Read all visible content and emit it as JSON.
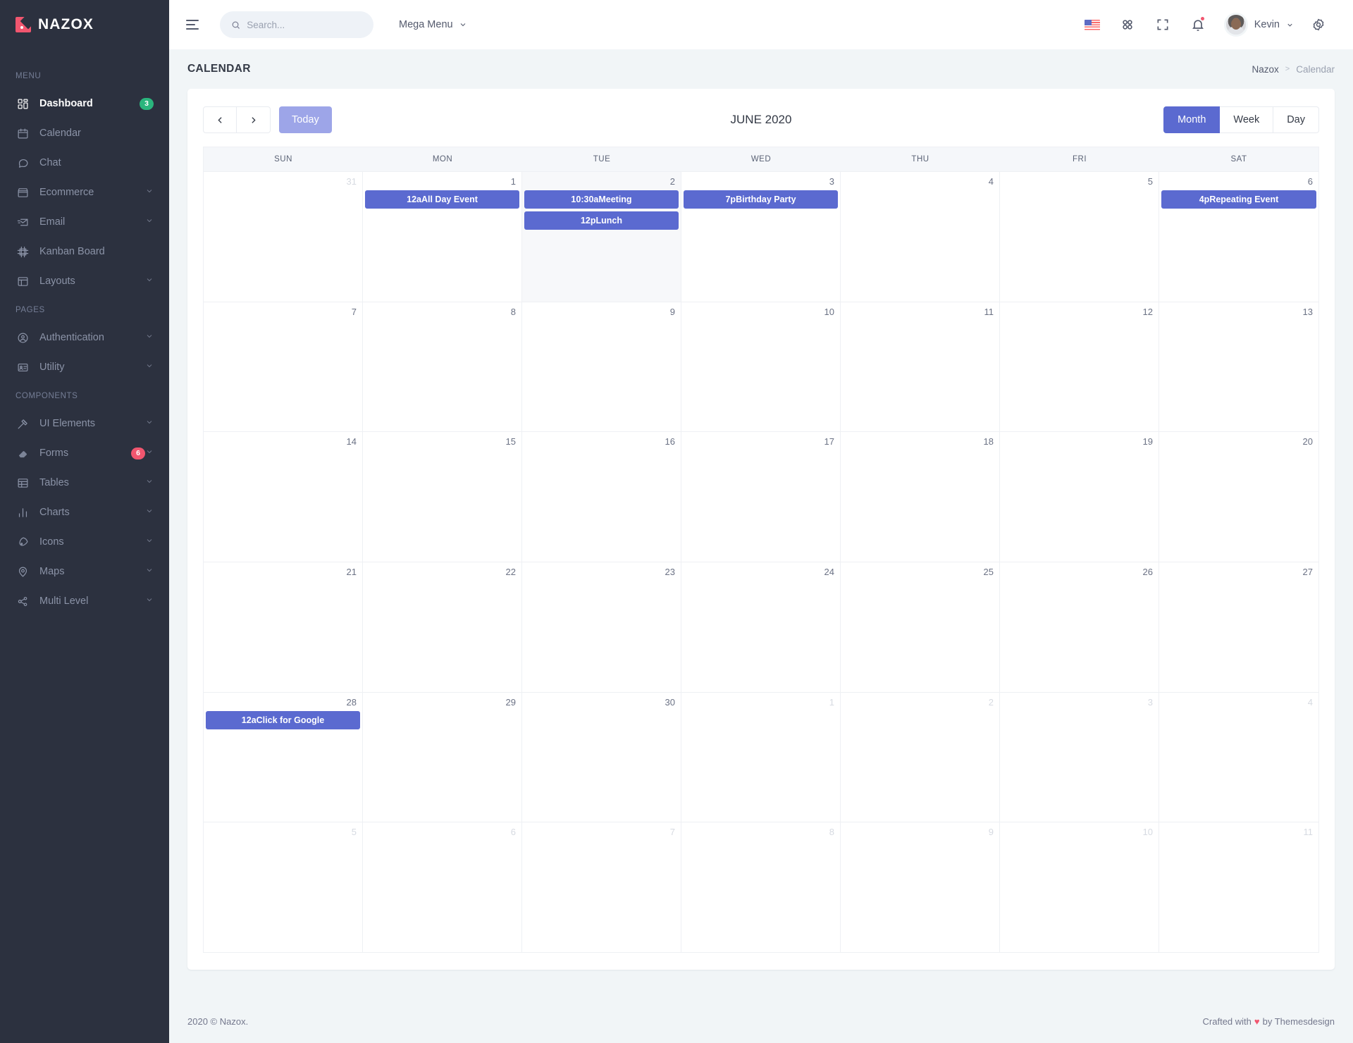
{
  "brand": {
    "name": "NAZOX",
    "logo_color": "#f1566f"
  },
  "sidebar": {
    "sections": [
      {
        "title": "MENU",
        "items": [
          {
            "label": "Dashboard",
            "icon": "grid-icon",
            "badge": "3",
            "badge_color": "#2ab57d",
            "active": true,
            "caret": false
          },
          {
            "label": "Calendar",
            "icon": "calendar-icon",
            "caret": false
          },
          {
            "label": "Chat",
            "icon": "chat-icon",
            "caret": false
          },
          {
            "label": "Ecommerce",
            "icon": "store-icon",
            "caret": true
          },
          {
            "label": "Email",
            "icon": "mail-icon",
            "caret": true
          },
          {
            "label": "Kanban Board",
            "icon": "kanban-icon",
            "caret": false
          },
          {
            "label": "Layouts",
            "icon": "layout-icon",
            "caret": true
          }
        ]
      },
      {
        "title": "PAGES",
        "items": [
          {
            "label": "Authentication",
            "icon": "user-circle-icon",
            "caret": true
          },
          {
            "label": "Utility",
            "icon": "id-card-icon",
            "caret": true
          }
        ]
      },
      {
        "title": "COMPONENTS",
        "items": [
          {
            "label": "UI Elements",
            "icon": "wand-icon",
            "caret": true
          },
          {
            "label": "Forms",
            "icon": "eraser-icon",
            "badge": "6",
            "badge_color": "#f1566f",
            "caret": true
          },
          {
            "label": "Tables",
            "icon": "table-icon",
            "caret": true
          },
          {
            "label": "Charts",
            "icon": "bar-chart-icon",
            "caret": true
          },
          {
            "label": "Icons",
            "icon": "rocket-icon",
            "caret": true
          },
          {
            "label": "Maps",
            "icon": "map-pin-icon",
            "caret": true
          },
          {
            "label": "Multi Level",
            "icon": "share-icon",
            "caret": true
          }
        ]
      }
    ]
  },
  "topbar": {
    "search_placeholder": "Search...",
    "search_value": "",
    "mega_menu_label": "Mega Menu",
    "language": "US",
    "user_name": "Kevin"
  },
  "page": {
    "title": "CALENDAR",
    "breadcrumb": [
      "Nazox",
      "Calendar"
    ],
    "breadcrumb_separator": ">"
  },
  "calendar": {
    "prev_label": "‹",
    "next_label": "›",
    "today_label": "Today",
    "title": "JUNE 2020",
    "views": [
      {
        "label": "Month",
        "active": true
      },
      {
        "label": "Week",
        "active": false
      },
      {
        "label": "Day",
        "active": false
      }
    ],
    "day_headers": [
      "SUN",
      "MON",
      "TUE",
      "WED",
      "THU",
      "FRI",
      "SAT"
    ],
    "event_color": "#5b6ad0",
    "weeks": [
      [
        {
          "num": "31",
          "other": true,
          "events": []
        },
        {
          "num": "1",
          "other": false,
          "events": [
            "12aAll Day Event"
          ]
        },
        {
          "num": "2",
          "other": false,
          "today": true,
          "events": [
            "10:30aMeeting",
            "12pLunch"
          ]
        },
        {
          "num": "3",
          "other": false,
          "events": [
            "7pBirthday Party"
          ]
        },
        {
          "num": "4",
          "other": false,
          "events": []
        },
        {
          "num": "5",
          "other": false,
          "events": []
        },
        {
          "num": "6",
          "other": false,
          "events": [
            "4pRepeating Event"
          ]
        }
      ],
      [
        {
          "num": "7",
          "other": false,
          "events": []
        },
        {
          "num": "8",
          "other": false,
          "events": []
        },
        {
          "num": "9",
          "other": false,
          "events": []
        },
        {
          "num": "10",
          "other": false,
          "events": []
        },
        {
          "num": "11",
          "other": false,
          "events": []
        },
        {
          "num": "12",
          "other": false,
          "events": []
        },
        {
          "num": "13",
          "other": false,
          "events": []
        }
      ],
      [
        {
          "num": "14",
          "other": false,
          "events": []
        },
        {
          "num": "15",
          "other": false,
          "events": []
        },
        {
          "num": "16",
          "other": false,
          "events": []
        },
        {
          "num": "17",
          "other": false,
          "events": []
        },
        {
          "num": "18",
          "other": false,
          "events": []
        },
        {
          "num": "19",
          "other": false,
          "events": []
        },
        {
          "num": "20",
          "other": false,
          "events": []
        }
      ],
      [
        {
          "num": "21",
          "other": false,
          "events": []
        },
        {
          "num": "22",
          "other": false,
          "events": []
        },
        {
          "num": "23",
          "other": false,
          "events": []
        },
        {
          "num": "24",
          "other": false,
          "events": []
        },
        {
          "num": "25",
          "other": false,
          "events": []
        },
        {
          "num": "26",
          "other": false,
          "events": []
        },
        {
          "num": "27",
          "other": false,
          "events": []
        }
      ],
      [
        {
          "num": "28",
          "other": false,
          "events": [
            "12aClick for Google"
          ]
        },
        {
          "num": "29",
          "other": false,
          "events": []
        },
        {
          "num": "30",
          "other": false,
          "events": []
        },
        {
          "num": "1",
          "other": true,
          "events": []
        },
        {
          "num": "2",
          "other": true,
          "events": []
        },
        {
          "num": "3",
          "other": true,
          "events": []
        },
        {
          "num": "4",
          "other": true,
          "events": []
        }
      ],
      [
        {
          "num": "5",
          "other": true,
          "events": []
        },
        {
          "num": "6",
          "other": true,
          "events": []
        },
        {
          "num": "7",
          "other": true,
          "events": []
        },
        {
          "num": "8",
          "other": true,
          "events": []
        },
        {
          "num": "9",
          "other": true,
          "events": []
        },
        {
          "num": "10",
          "other": true,
          "events": []
        },
        {
          "num": "11",
          "other": true,
          "events": []
        }
      ]
    ]
  },
  "footer": {
    "copyright": "2020 © Nazox.",
    "crafted_prefix": "Crafted with",
    "heart": "♥",
    "crafted_suffix": "by Themesdesign"
  }
}
